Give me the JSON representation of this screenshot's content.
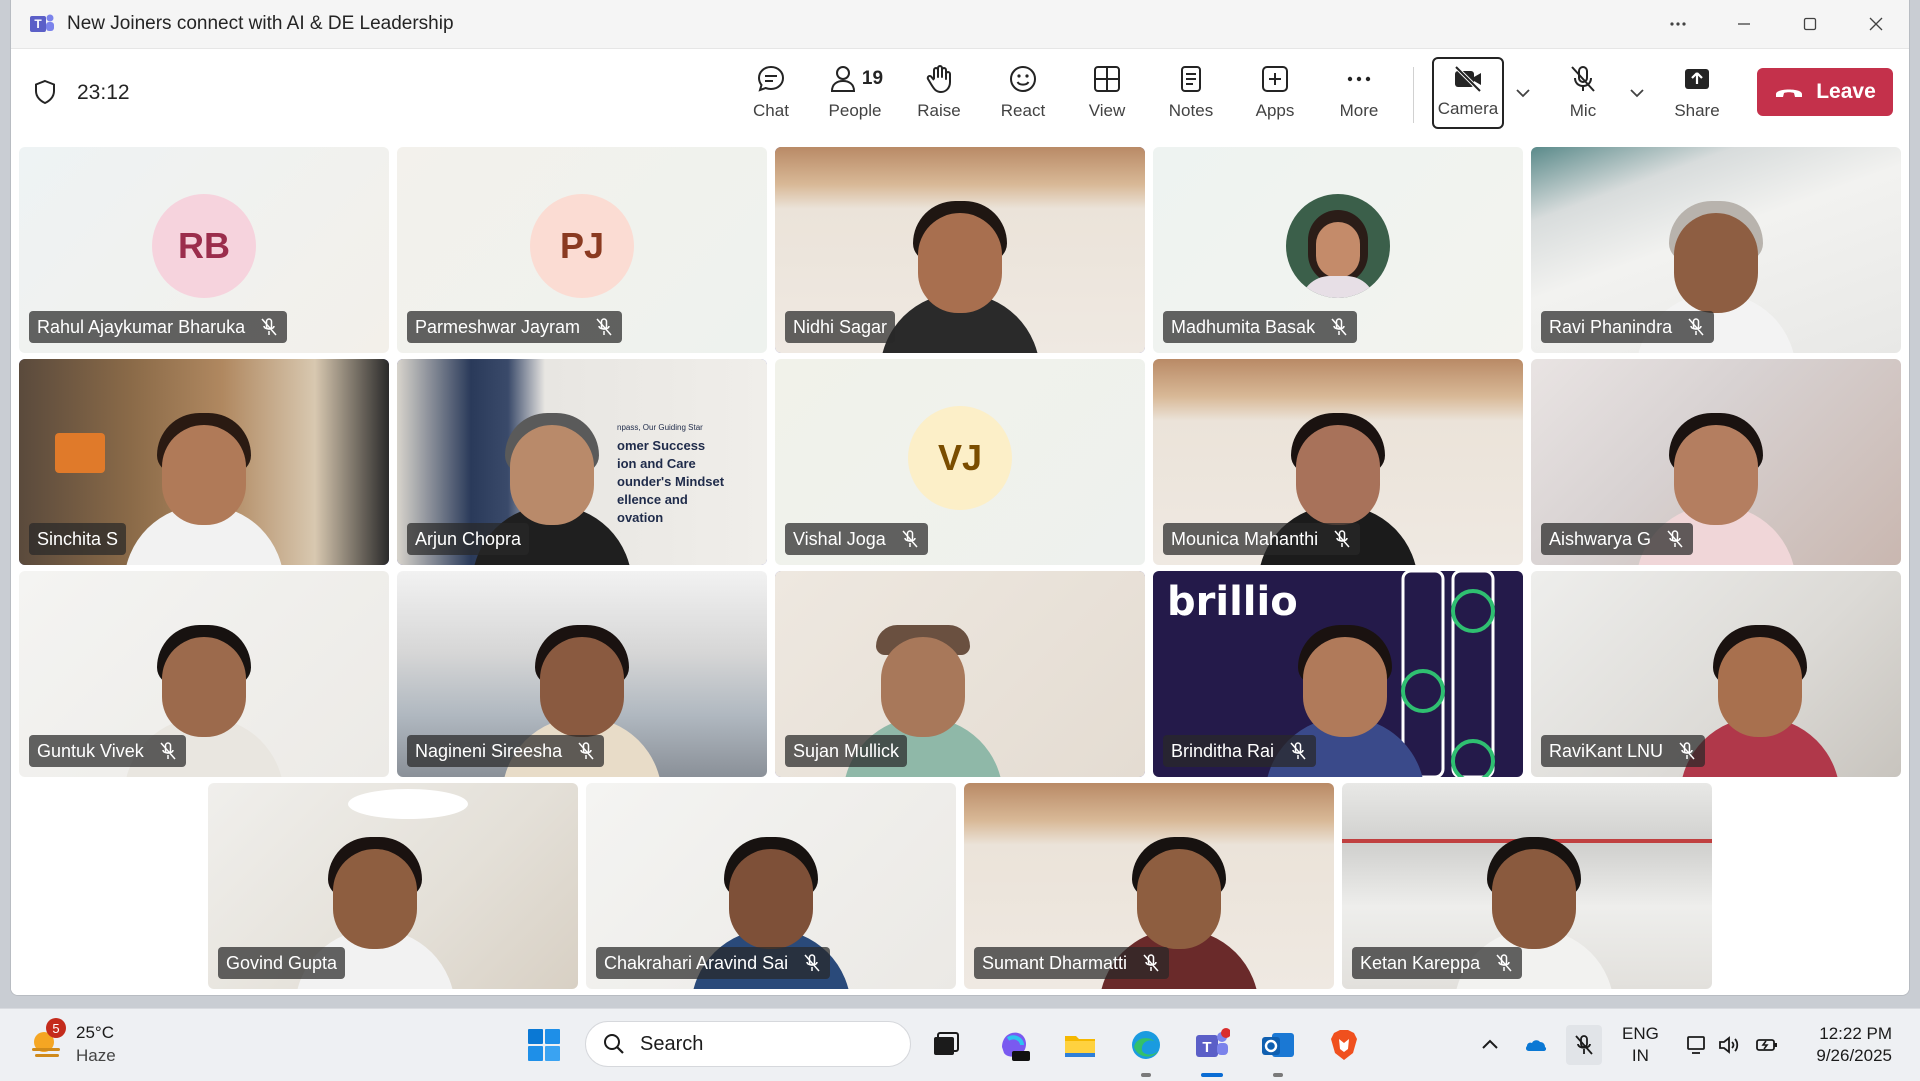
{
  "window": {
    "title": "New Joiners connect with AI & DE Leadership"
  },
  "meeting": {
    "timer": "23:12",
    "toolbar": {
      "chat": "Chat",
      "people": "People",
      "people_count": "19",
      "raise": "Raise",
      "react": "React",
      "view": "View",
      "notes": "Notes",
      "apps": "Apps",
      "more": "More",
      "camera": "Camera",
      "mic": "Mic",
      "share": "Share",
      "leave": "Leave"
    },
    "participants": [
      {
        "name": "Rahul Ajaykumar Bharuka",
        "initials": "RB",
        "muted": true
      },
      {
        "name": "Parmeshwar Jayram",
        "initials": "PJ",
        "muted": true
      },
      {
        "name": "Nidhi Sagar",
        "muted": false
      },
      {
        "name": "Madhumita Basak",
        "muted": true
      },
      {
        "name": "Ravi Phanindra",
        "muted": true
      },
      {
        "name": "Sinchita S",
        "muted": false
      },
      {
        "name": "Arjun Chopra",
        "muted": false
      },
      {
        "name": "Vishal Joga",
        "initials": "VJ",
        "muted": true
      },
      {
        "name": "Mounica Mahanthi",
        "muted": true
      },
      {
        "name": "Aishwarya G",
        "muted": true
      },
      {
        "name": "Guntuk Vivek",
        "muted": true
      },
      {
        "name": "Nagineni Sireesha",
        "muted": true
      },
      {
        "name": "Sujan Mullick",
        "muted": false
      },
      {
        "name": "Brinditha Rai",
        "muted": true
      },
      {
        "name": "RaviKant LNU",
        "muted": true
      },
      {
        "name": "Govind Gupta",
        "muted": false
      },
      {
        "name": "Chakrahari Aravind Sai",
        "muted": true
      },
      {
        "name": "Sumant Dharmatti",
        "muted": true
      },
      {
        "name": "Ketan Kareppa",
        "muted": true
      }
    ],
    "background_texts": {
      "brillio_logo": "brillio",
      "poster_lines": [
        "npass, Our Guiding Star",
        "omer Success",
        "ion and Care",
        "ounder's Mindset",
        "ellence and",
        "ovation"
      ]
    }
  },
  "taskbar": {
    "weather_temp": "25°C",
    "weather_desc": "Haze",
    "weather_badge": "5",
    "search_placeholder": "Search",
    "lang_line1": "ENG",
    "lang_line2": "IN",
    "time": "12:22 PM",
    "date": "9/26/2025"
  },
  "colors": {
    "leave": "#c4314b",
    "speaking_outline": "#5b5fc7",
    "teams_purple": "#5b5fc7"
  }
}
